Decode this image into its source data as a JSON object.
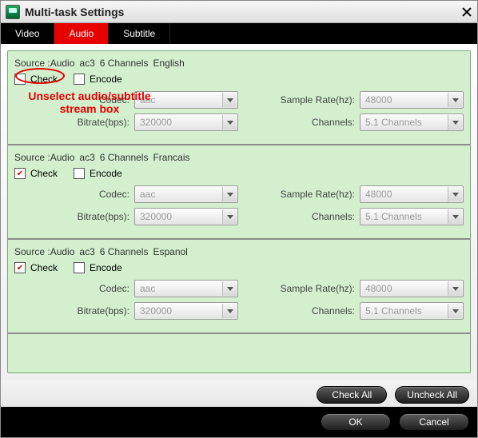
{
  "window": {
    "title": "Multi-task Settings"
  },
  "tabs": {
    "video": "Video",
    "audio": "Audio",
    "subtitle": "Subtitle",
    "active": "audio"
  },
  "labels": {
    "source_prefix": "Source :Audio",
    "check": "Check",
    "encode": "Encode",
    "codec": "Codec:",
    "sample_rate": "Sample Rate(hz):",
    "bitrate": "Bitrate(bps):",
    "channels": "Channels:"
  },
  "streams": [
    {
      "codec_name": "ac3",
      "ch_text": "6 Channels",
      "lang": "English",
      "checked": false,
      "encode": false,
      "codec_value": "aac",
      "sample_rate": "48000",
      "bitrate": "320000",
      "channels": "5.1 Channels"
    },
    {
      "codec_name": "ac3",
      "ch_text": "6 Channels",
      "lang": "Francais",
      "checked": true,
      "encode": false,
      "codec_value": "aac",
      "sample_rate": "48000",
      "bitrate": "320000",
      "channels": "5.1 Channels"
    },
    {
      "codec_name": "ac3",
      "ch_text": "6 Channels",
      "lang": "Espanol",
      "checked": true,
      "encode": false,
      "codec_value": "aac",
      "sample_rate": "48000",
      "bitrate": "320000",
      "channels": "5.1 Channels"
    }
  ],
  "buttons": {
    "check_all": "Check All",
    "uncheck_all": "Uncheck All",
    "ok": "OK",
    "cancel": "Cancel"
  },
  "annotation": {
    "text_line1": "Unselect audio/subtitle",
    "text_line2": "stream box"
  }
}
